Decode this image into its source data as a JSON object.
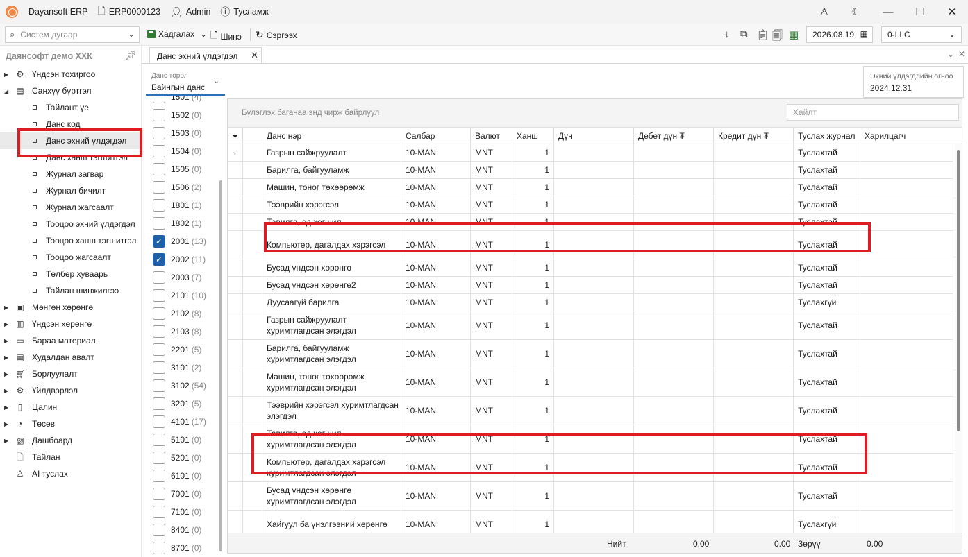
{
  "titlebar": {
    "app_name": "Dayansoft ERP",
    "record_no": "ERP0000123",
    "user": "Admin",
    "help": "Тусламж"
  },
  "toolbar": {
    "search_placeholder": "Систем дугаар",
    "save_label": "Хадгалах",
    "new_label": "Шинэ",
    "refresh_label": "Сэргээх",
    "date": "2026.08.19",
    "company": "0-LLC"
  },
  "sidebar": {
    "header": "Даянсофт демо ХХК",
    "items": [
      {
        "label": "Үндсэн тохиргоо",
        "icon": "gear-icon"
      },
      {
        "label": "Санхүү бүртгэл",
        "icon": "ledger-icon"
      }
    ],
    "sub_items": [
      {
        "label": "Тайлант үе"
      },
      {
        "label": "Данс код"
      },
      {
        "label": "Данс эхний үлдэгдэл"
      },
      {
        "label": "Данс ханш тэгшитгэл"
      },
      {
        "label": "Журнал загвар"
      },
      {
        "label": "Журнал бичилт"
      },
      {
        "label": "Журнал жагсаалт"
      },
      {
        "label": "Тооцоо эхний үлдэгдэл"
      },
      {
        "label": "Тооцоо ханш тэгшитгэл"
      },
      {
        "label": "Тооцоо жагсаалт"
      },
      {
        "label": "Төлбөр хуваарь"
      },
      {
        "label": "Тайлан шинжилгээ"
      }
    ],
    "modules": [
      {
        "label": "Мөнгөн хөрөнгө",
        "icon": "cash-icon"
      },
      {
        "label": "Үндсэн хөрөнгө",
        "icon": "asset-icon"
      },
      {
        "label": "Бараа материал",
        "icon": "inventory-icon"
      },
      {
        "label": "Худалдан авалт",
        "icon": "purchase-icon"
      },
      {
        "label": "Борлуулалт",
        "icon": "cart-icon"
      },
      {
        "label": "Үйлдвэрлэл",
        "icon": "factory-icon"
      },
      {
        "label": "Цалин",
        "icon": "payroll-icon"
      },
      {
        "label": "Төсөв",
        "icon": "pie-icon"
      },
      {
        "label": "Дашбоард",
        "icon": "dashboard-icon"
      },
      {
        "label": "Тайлан",
        "icon": "report-icon"
      },
      {
        "label": "AI туслах",
        "icon": "ai-assistant-icon"
      }
    ]
  },
  "tab": {
    "label": "Данс эхний үлдэгдэл"
  },
  "filter": {
    "account_type_label": "Данс төрөл",
    "account_type_value": "Байнгын данс",
    "codes": [
      {
        "code": "1501",
        "count": "(4)",
        "checked": false
      },
      {
        "code": "1502",
        "count": "(0)",
        "checked": false
      },
      {
        "code": "1503",
        "count": "(0)",
        "checked": false
      },
      {
        "code": "1504",
        "count": "(0)",
        "checked": false
      },
      {
        "code": "1505",
        "count": "(0)",
        "checked": false
      },
      {
        "code": "1506",
        "count": "(2)",
        "checked": false
      },
      {
        "code": "1801",
        "count": "(1)",
        "checked": false
      },
      {
        "code": "1802",
        "count": "(1)",
        "checked": false
      },
      {
        "code": "2001",
        "count": "(13)",
        "checked": true
      },
      {
        "code": "2002",
        "count": "(11)",
        "checked": true
      },
      {
        "code": "2003",
        "count": "(7)",
        "checked": false
      },
      {
        "code": "2101",
        "count": "(10)",
        "checked": false
      },
      {
        "code": "2102",
        "count": "(8)",
        "checked": false
      },
      {
        "code": "2103",
        "count": "(8)",
        "checked": false
      },
      {
        "code": "2201",
        "count": "(5)",
        "checked": false
      },
      {
        "code": "3101",
        "count": "(2)",
        "checked": false
      },
      {
        "code": "3102",
        "count": "(54)",
        "checked": false
      },
      {
        "code": "3201",
        "count": "(5)",
        "checked": false
      },
      {
        "code": "4101",
        "count": "(17)",
        "checked": false
      },
      {
        "code": "5101",
        "count": "(0)",
        "checked": false
      },
      {
        "code": "5201",
        "count": "(0)",
        "checked": false
      },
      {
        "code": "6101",
        "count": "(0)",
        "checked": false
      },
      {
        "code": "7001",
        "count": "(0)",
        "checked": false
      },
      {
        "code": "7101",
        "count": "(0)",
        "checked": false
      },
      {
        "code": "8401",
        "count": "(0)",
        "checked": false
      },
      {
        "code": "8701",
        "count": "(0)",
        "checked": false
      }
    ]
  },
  "opening_date": {
    "label": "Эхний үлдэгдлийн огноо",
    "value": "2024.12.31"
  },
  "grid": {
    "group_hint": "Бүлэглэх баганаа энд чирж байрлуул",
    "search_placeholder": "Хайлт",
    "columns": [
      "Данс нэр",
      "Салбар",
      "Валют",
      "Ханш",
      "Дүн",
      "Дебет дүн ₮",
      "Кредит дүн ₮",
      "Туслах журнал",
      "Харилцагч"
    ],
    "rows": [
      {
        "name": "Газрын сайжруулалт",
        "branch": "10-MAN",
        "currency": "MNT",
        "rate": "1",
        "journal": "Туслахтай"
      },
      {
        "name": "Барилга, байгууламж",
        "branch": "10-MAN",
        "currency": "MNT",
        "rate": "1",
        "journal": "Туслахтай"
      },
      {
        "name": "Машин, тоног төхөөрөмж",
        "branch": "10-MAN",
        "currency": "MNT",
        "rate": "1",
        "journal": "Туслахтай"
      },
      {
        "name": "Тээврийн хэрэгсэл",
        "branch": "10-MAN",
        "currency": "MNT",
        "rate": "1",
        "journal": "Туслахтай"
      },
      {
        "name": "Тавилга, эд хогшил",
        "branch": "10-MAN",
        "currency": "MNT",
        "rate": "1",
        "journal": "Туслахтай"
      },
      {
        "name": "Компьютер, дагалдах хэрэгсэл",
        "branch": "10-MAN",
        "currency": "MNT",
        "rate": "1",
        "journal": "Туслахтай"
      },
      {
        "name": "Бусад үндсэн хөрөнгө",
        "branch": "10-MAN",
        "currency": "MNT",
        "rate": "1",
        "journal": "Туслахтай"
      },
      {
        "name": "Бусад үндсэн хөрөнгө2",
        "branch": "10-MAN",
        "currency": "MNT",
        "rate": "1",
        "journal": "Туслахтай"
      },
      {
        "name": "Дуусаагүй барилга",
        "branch": "10-MAN",
        "currency": "MNT",
        "rate": "1",
        "journal": "Туслахгүй"
      },
      {
        "name": "Газрын сайжруулалт хуримтлагдсан элэгдэл",
        "branch": "10-MAN",
        "currency": "MNT",
        "rate": "1",
        "journal": "Туслахтай"
      },
      {
        "name": "Барилга, байгууламж хуримтлагдсан элэгдэл",
        "branch": "10-MAN",
        "currency": "MNT",
        "rate": "1",
        "journal": "Туслахтай"
      },
      {
        "name": "Машин, тоног төхөөрөмж хуримтлагдсан элэгдэл",
        "branch": "10-MAN",
        "currency": "MNT",
        "rate": "1",
        "journal": "Туслахтай"
      },
      {
        "name": "Тээврийн хэрэгсэл хуримтлагдсан элэгдэл",
        "branch": "10-MAN",
        "currency": "MNT",
        "rate": "1",
        "journal": "Туслахтай"
      },
      {
        "name": "Тавилга, эд хогшил хуримтлагдсан элэгдэл",
        "branch": "10-MAN",
        "currency": "MNT",
        "rate": "1",
        "journal": "Туслахтай"
      },
      {
        "name": "Компьютер, дагалдах хэрэгсэл хуримтлагдсан элэгдэл",
        "branch": "10-MAN",
        "currency": "MNT",
        "rate": "1",
        "journal": "Туслахтай"
      },
      {
        "name": "Бусад үндсэн хөрөнгө хуримтлагдсан элэгдэл",
        "branch": "10-MAN",
        "currency": "MNT",
        "rate": "1",
        "journal": "Туслахтай"
      },
      {
        "name": "Хайгуул ба үнэлгээний хөрөнгө",
        "branch": "10-MAN",
        "currency": "MNT",
        "rate": "1",
        "journal": "Туслахгүй"
      },
      {
        "name": "Хайгуул ба үнэлгээний хөрөнгө",
        "branch": "10-MAN",
        "currency": "MNT",
        "rate": "1",
        "journal": "Туслахгүй"
      }
    ],
    "totals": {
      "label": "Нийт",
      "debit": "0.00",
      "credit": "0.00",
      "diff_label": "Зөрүү",
      "diff": "0.00"
    }
  }
}
